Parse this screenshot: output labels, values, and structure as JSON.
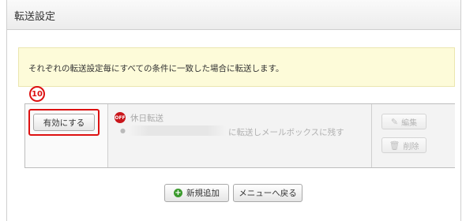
{
  "header": {
    "title": "転送設定"
  },
  "notice": {
    "text": "それぞれの転送設定毎にすべての条件に一致した場合に転送します。"
  },
  "annotation": {
    "marker": "10"
  },
  "rule": {
    "enable_label": "有効にする",
    "status_badge": "OFF",
    "name": "休日転送",
    "description": "に転送しメールボックスに残す",
    "edit_label": "編集",
    "delete_label": "削除"
  },
  "footer": {
    "add_label": "新規追加",
    "menu_label": "メニューへ戻る"
  },
  "colors": {
    "highlight": "#d11111",
    "notice_bg": "#fdfbd9",
    "off_badge": "#c9161b",
    "add_icon": "#3a9a2c"
  },
  "icons": {
    "edit": "pencil-icon",
    "delete": "trash-icon",
    "add": "plus-circle-icon"
  }
}
